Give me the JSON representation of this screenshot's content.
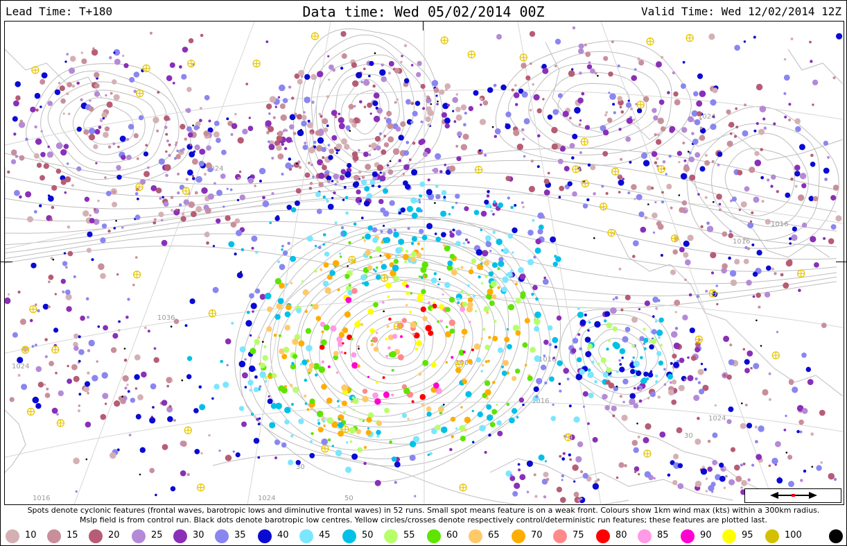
{
  "header": {
    "lead_time": "Lead Time: T+180",
    "data_time": "Data time:  Wed 05/02/2014 00Z",
    "valid_time": "Valid Time: Wed 12/02/2014 12Z"
  },
  "caption": {
    "line1": "Spots denote cyclonic features (frontal waves, barotropic lows and diminutive frontal waves) in 52 runs. Small spot means feature is on a weak front. Colours show 1km wind max (kts) within a 300km radius.",
    "line2": "Mslp field is from control run. Black dots denote barotropic low centres. Yellow circles/crosses denote respectively control/deterministic run features; these features are plotted last."
  },
  "legend": [
    {
      "label": "10",
      "color": "#d4b0b4"
    },
    {
      "label": "15",
      "color": "#c88f9b"
    },
    {
      "label": "20",
      "color": "#b65d75"
    },
    {
      "label": "25",
      "color": "#b48ad6"
    },
    {
      "label": "30",
      "color": "#8a2fb8"
    },
    {
      "label": "35",
      "color": "#8a86f0"
    },
    {
      "label": "40",
      "color": "#0a0ad4"
    },
    {
      "label": "45",
      "color": "#7ae6ff"
    },
    {
      "label": "50",
      "color": "#00c0e8"
    },
    {
      "label": "55",
      "color": "#b6ff6a"
    },
    {
      "label": "60",
      "color": "#5fe400"
    },
    {
      "label": "65",
      "color": "#ffc96a"
    },
    {
      "label": "70",
      "color": "#ffad00"
    },
    {
      "label": "75",
      "color": "#ff8a8a"
    },
    {
      "label": "80",
      "color": "#ff0000"
    },
    {
      "label": "85",
      "color": "#ff9ae6"
    },
    {
      "label": "90",
      "color": "#ff00d0"
    },
    {
      "label": "95",
      "color": "#ffff00"
    },
    {
      "label": "100",
      "color": "#d4c000"
    },
    {
      "label": "",
      "color": "#000000"
    }
  ],
  "isobar_labels": [
    "1024",
    "1024",
    "1016",
    "1016",
    "1024",
    "1036",
    "1024",
    "1016",
    "1000",
    "1016",
    "30",
    "30",
    "50",
    "1024",
    "1016"
  ],
  "map_style": {
    "isobar_color": "#bdbdbd",
    "coast_color": "#c8c8c8"
  }
}
